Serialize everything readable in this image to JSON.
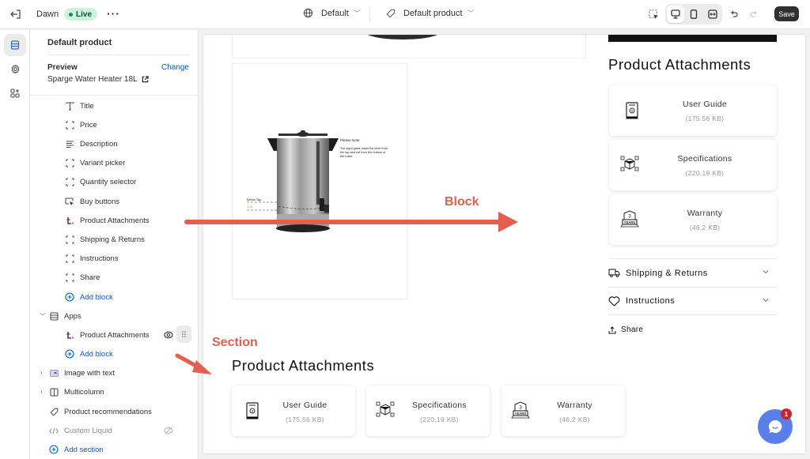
{
  "topbar": {
    "theme_name": "Dawn",
    "live_label": "Live",
    "more_label": "···",
    "market_label": "Default",
    "template_label": "Default product",
    "save_label": "Save"
  },
  "sidebar": {
    "title": "Default product",
    "preview_label": "Preview",
    "change_label": "Change",
    "preview_value": "Sparge Water Heater 18L",
    "blocks": [
      {
        "label": "Title",
        "icon": "text-icon"
      },
      {
        "label": "Price",
        "icon": "block-icon"
      },
      {
        "label": "Description",
        "icon": "text-lines-icon"
      },
      {
        "label": "Variant picker",
        "icon": "block-icon"
      },
      {
        "label": "Quantity selector",
        "icon": "block-icon"
      },
      {
        "label": "Buy buttons",
        "icon": "cursor-button-icon"
      },
      {
        "label": "Product Attachments",
        "icon": "app-icon"
      },
      {
        "label": "Shipping & Returns",
        "icon": "block-icon"
      },
      {
        "label": "Instructions",
        "icon": "block-icon"
      },
      {
        "label": "Share",
        "icon": "block-icon"
      }
    ],
    "add_block_label": "Add block",
    "apps_label": "Apps",
    "apps_block_label": "Product Attachments",
    "apps_add_block_label": "Add block",
    "sections": [
      {
        "label": "Image with text"
      },
      {
        "label": "Multicolumn"
      },
      {
        "label": "Product recommendations"
      },
      {
        "label": "Custom Liquid"
      }
    ],
    "add_section_label": "Add section"
  },
  "preview": {
    "image_note_title": "Please Note",
    "image_note_text": "The sight glass reads the level from the tap and not from the bottom of the boiler.",
    "image_below_tap": "Below Tap",
    "image_volume": "1.5L",
    "block_heading": "Product Attachments",
    "attachments": [
      {
        "name": "User Guide",
        "size": "(175.56 KB)"
      },
      {
        "name": "Specifications",
        "size": "(220.19 KB)"
      },
      {
        "name": "Warranty",
        "size": "(46.2 KB)"
      }
    ],
    "accordions": [
      {
        "label": "Shipping & Returns"
      },
      {
        "label": "Instructions"
      }
    ],
    "share_label": "Share",
    "section_heading": "Product Attachments"
  },
  "annotations": {
    "block": "Block",
    "section": "Section",
    "color": "#e45f4e"
  },
  "chat": {
    "badge_count": "1"
  }
}
